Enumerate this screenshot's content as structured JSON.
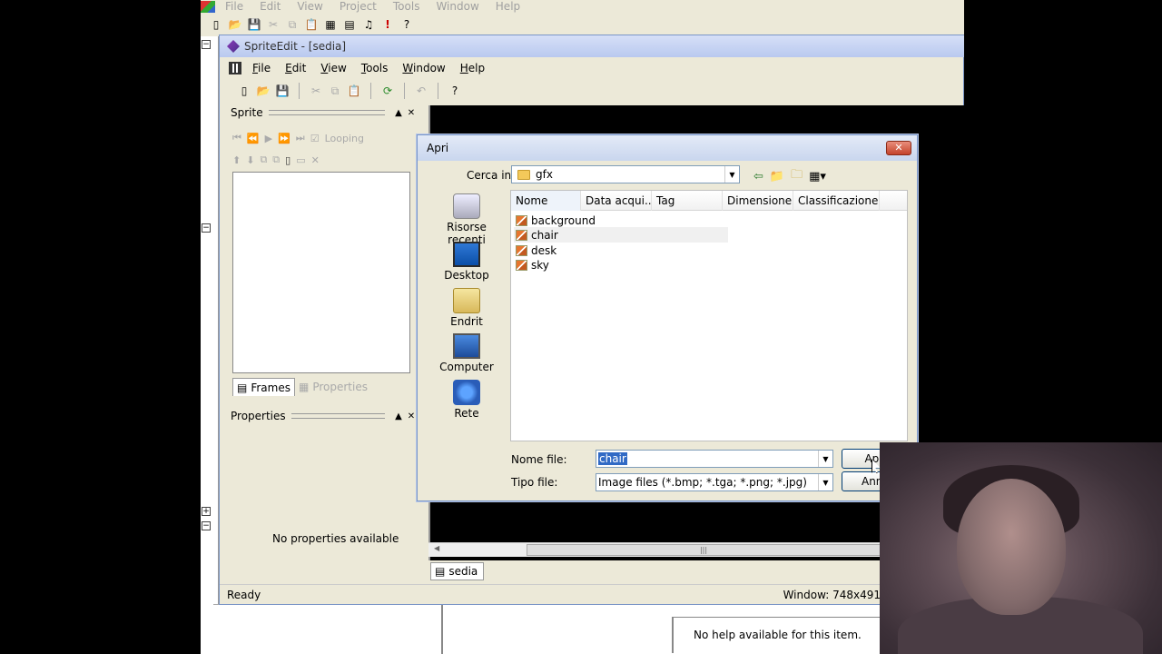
{
  "outer": {
    "menu": [
      "File",
      "Edit",
      "View",
      "Project",
      "Tools",
      "Window",
      "Help"
    ],
    "help_text": "No help available for this item."
  },
  "sprite_window": {
    "title": "SpriteEdit - [sedia]",
    "menu": [
      "File",
      "Edit",
      "View",
      "Tools",
      "Window",
      "Help"
    ],
    "sprite_panel": {
      "title": "Sprite",
      "looping_label": "Looping",
      "tabs": [
        "Frames",
        "Properties"
      ]
    },
    "properties_panel": {
      "title": "Properties",
      "empty_text": "No properties available"
    },
    "doc_tab": "sedia",
    "status_left": "Ready",
    "status_right": "Window: 748x491"
  },
  "dialog": {
    "title": "Apri",
    "look_in_label": "Cerca in:",
    "look_in_value": "gfx",
    "places": [
      "Risorse recenti",
      "Desktop",
      "Endrit",
      "Computer",
      "Rete"
    ],
    "columns": [
      "Nome",
      "Data acqui...",
      "Tag",
      "Dimensione",
      "Classificazione"
    ],
    "files": [
      "background",
      "chair",
      "desk",
      "sky"
    ],
    "selected_file_index": 1,
    "filename_label": "Nome file:",
    "filename_value": "chair",
    "filetype_label": "Tipo file:",
    "filetype_value": "Image files (*.bmp; *.tga; *.png; *.jpg)",
    "open_button": "Apri",
    "cancel_button": "Annu"
  }
}
